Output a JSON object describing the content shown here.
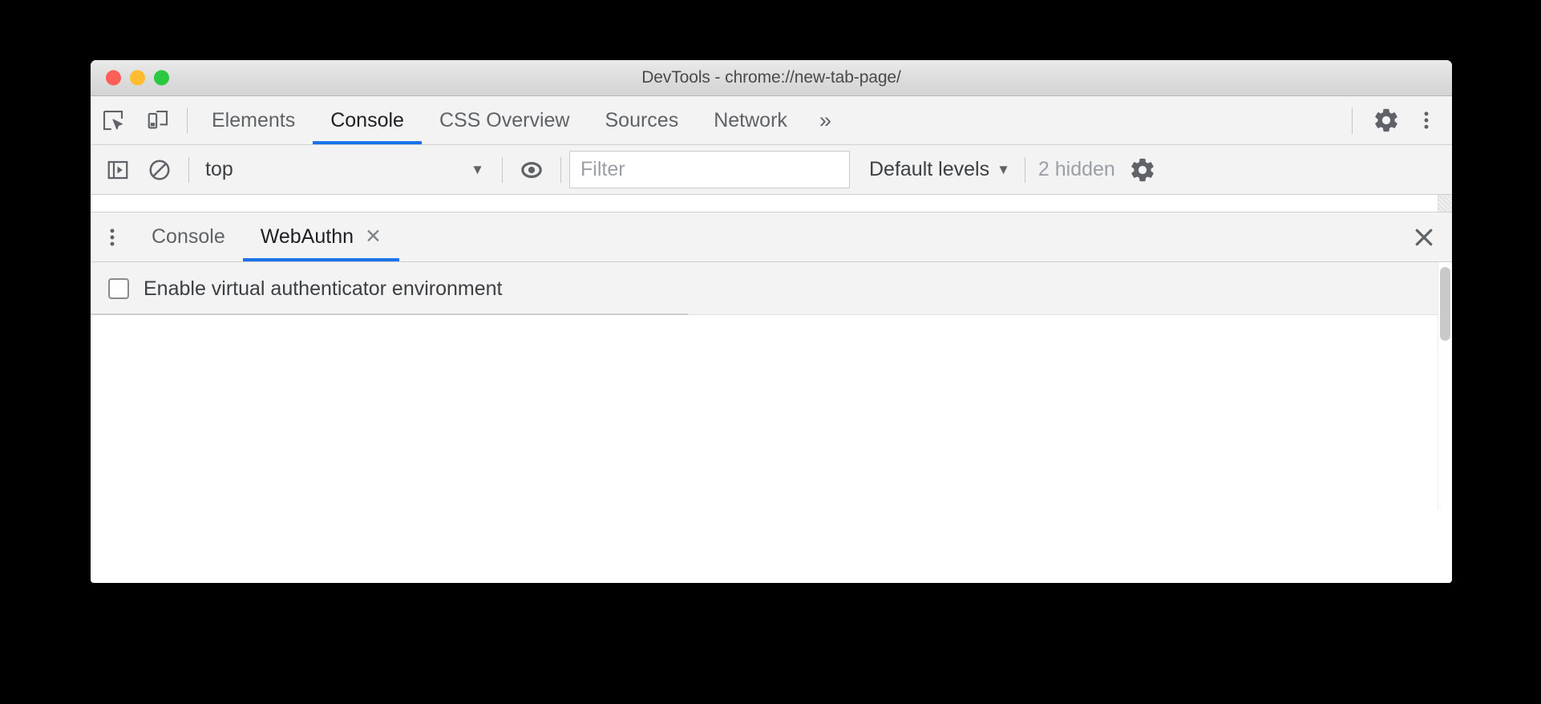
{
  "window": {
    "title": "DevTools - chrome://new-tab-page/",
    "traffic_lights": {
      "close_label": "close",
      "minimize_label": "minimize",
      "zoom_label": "zoom",
      "close_color": "#ff5f57",
      "minimize_color": "#febc2e",
      "zoom_color": "#2cc840"
    }
  },
  "main_tabs": {
    "inspect_icon": "inspect-element-icon",
    "device_icon": "device-toolbar-icon",
    "items": [
      {
        "label": "Elements",
        "active": false
      },
      {
        "label": "Console",
        "active": true
      },
      {
        "label": "CSS Overview",
        "active": false
      },
      {
        "label": "Sources",
        "active": false
      },
      {
        "label": "Network",
        "active": false
      }
    ],
    "more_tabs_label": "»",
    "settings_icon": "gear-icon",
    "more_options_icon": "kebab-menu-icon",
    "active_underline_color": "#1a73e8"
  },
  "console_toolbar": {
    "sidebar_toggle_icon": "console-sidebar-toggle-icon",
    "clear_console_icon": "clear-console-icon",
    "context": {
      "value": "top",
      "caret": "▼"
    },
    "live_expressions_icon": "eye-icon",
    "filter": {
      "placeholder": "Filter",
      "value": ""
    },
    "levels": {
      "value": "Default levels",
      "caret": "▼"
    },
    "hidden_messages": "2 hidden",
    "settings_icon": "gear-icon"
  },
  "drawer": {
    "menu_icon": "kebab-menu-icon",
    "tabs": [
      {
        "label": "Console",
        "active": false,
        "closable": false
      },
      {
        "label": "WebAuthn",
        "active": true,
        "closable": true,
        "close_glyph": "✕"
      }
    ],
    "close_drawer_glyph": "✕",
    "active_underline_color": "#1a73e8",
    "content": {
      "enable_checkbox": {
        "label": "Enable virtual authenticator environment",
        "checked": false
      }
    }
  }
}
